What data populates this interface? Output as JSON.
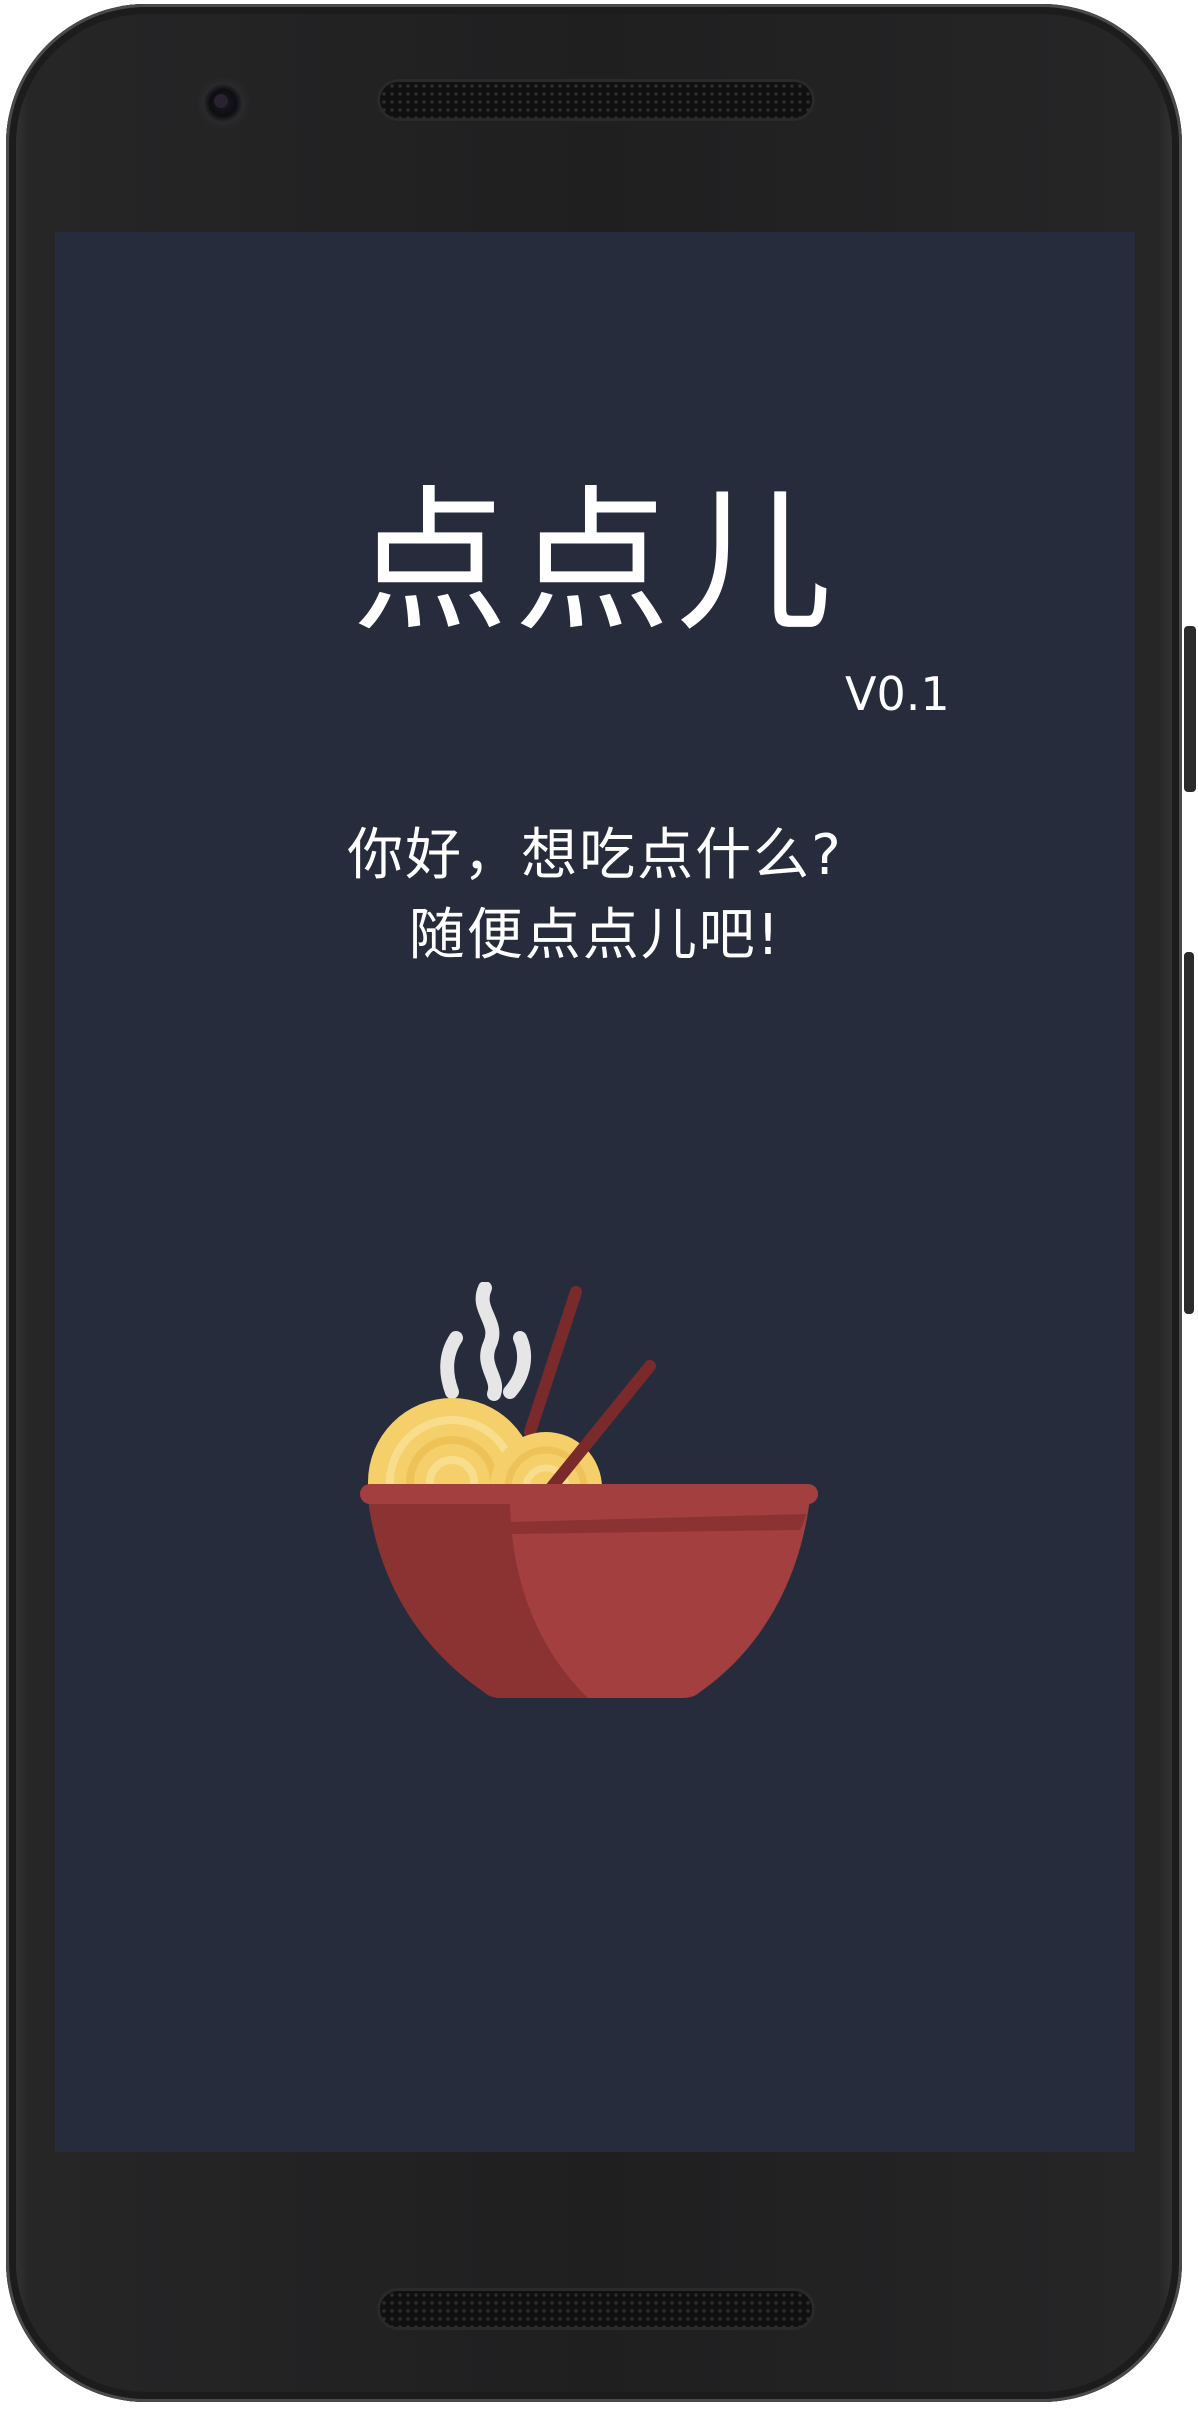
{
  "app": {
    "title": "点点儿",
    "version": "V0.1",
    "greeting_line1": "你好，想吃点什么?",
    "greeting_line2": "随便点点儿吧!"
  },
  "illustration": {
    "icon": "noodle-bowl-icon",
    "colors": {
      "bowl": "#a43f3f",
      "bowl_shadow": "#8b3233",
      "noodles": "#f4cf6a",
      "chopsticks": "#7a2a2a",
      "steam": "#e6e6e6"
    }
  },
  "theme": {
    "screen_background": "#272c3d",
    "text_color": "#ffffff"
  }
}
